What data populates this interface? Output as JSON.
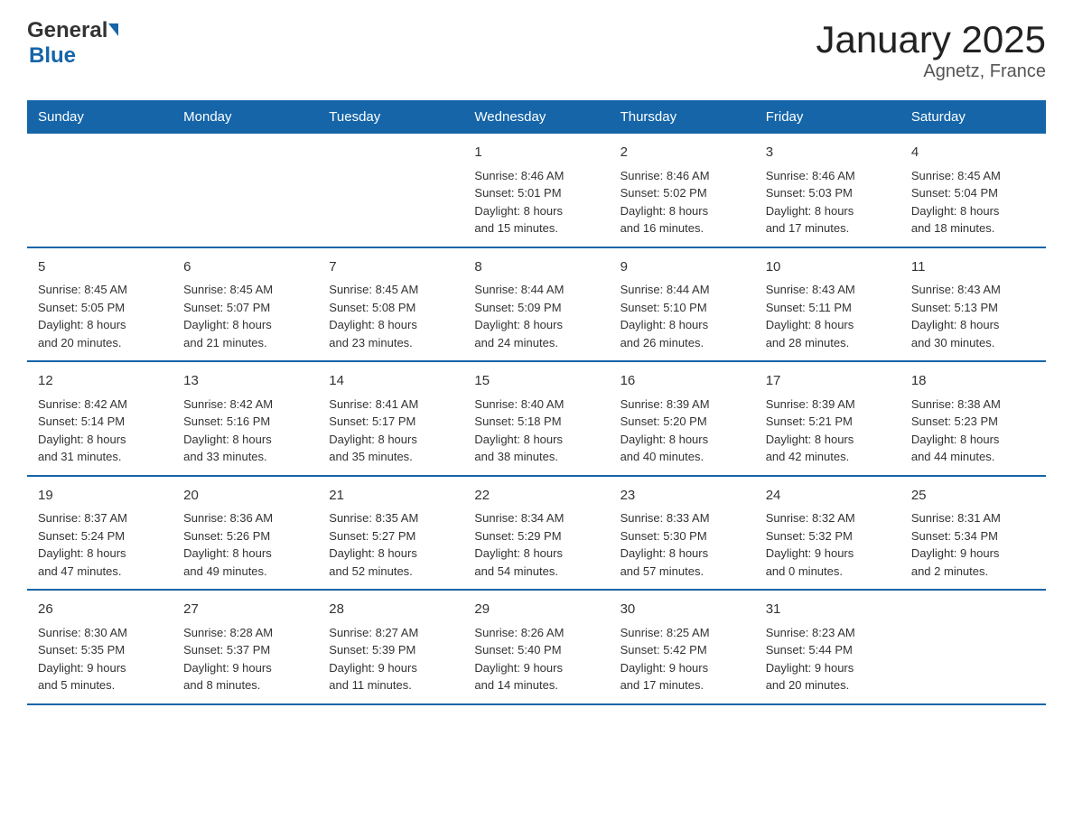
{
  "header": {
    "logo_general": "General",
    "logo_blue": "Blue",
    "title": "January 2025",
    "subtitle": "Agnetz, France"
  },
  "days_of_week": [
    "Sunday",
    "Monday",
    "Tuesday",
    "Wednesday",
    "Thursday",
    "Friday",
    "Saturday"
  ],
  "weeks": [
    [
      {
        "day": "",
        "info": ""
      },
      {
        "day": "",
        "info": ""
      },
      {
        "day": "",
        "info": ""
      },
      {
        "day": "1",
        "info": "Sunrise: 8:46 AM\nSunset: 5:01 PM\nDaylight: 8 hours\nand 15 minutes."
      },
      {
        "day": "2",
        "info": "Sunrise: 8:46 AM\nSunset: 5:02 PM\nDaylight: 8 hours\nand 16 minutes."
      },
      {
        "day": "3",
        "info": "Sunrise: 8:46 AM\nSunset: 5:03 PM\nDaylight: 8 hours\nand 17 minutes."
      },
      {
        "day": "4",
        "info": "Sunrise: 8:45 AM\nSunset: 5:04 PM\nDaylight: 8 hours\nand 18 minutes."
      }
    ],
    [
      {
        "day": "5",
        "info": "Sunrise: 8:45 AM\nSunset: 5:05 PM\nDaylight: 8 hours\nand 20 minutes."
      },
      {
        "day": "6",
        "info": "Sunrise: 8:45 AM\nSunset: 5:07 PM\nDaylight: 8 hours\nand 21 minutes."
      },
      {
        "day": "7",
        "info": "Sunrise: 8:45 AM\nSunset: 5:08 PM\nDaylight: 8 hours\nand 23 minutes."
      },
      {
        "day": "8",
        "info": "Sunrise: 8:44 AM\nSunset: 5:09 PM\nDaylight: 8 hours\nand 24 minutes."
      },
      {
        "day": "9",
        "info": "Sunrise: 8:44 AM\nSunset: 5:10 PM\nDaylight: 8 hours\nand 26 minutes."
      },
      {
        "day": "10",
        "info": "Sunrise: 8:43 AM\nSunset: 5:11 PM\nDaylight: 8 hours\nand 28 minutes."
      },
      {
        "day": "11",
        "info": "Sunrise: 8:43 AM\nSunset: 5:13 PM\nDaylight: 8 hours\nand 30 minutes."
      }
    ],
    [
      {
        "day": "12",
        "info": "Sunrise: 8:42 AM\nSunset: 5:14 PM\nDaylight: 8 hours\nand 31 minutes."
      },
      {
        "day": "13",
        "info": "Sunrise: 8:42 AM\nSunset: 5:16 PM\nDaylight: 8 hours\nand 33 minutes."
      },
      {
        "day": "14",
        "info": "Sunrise: 8:41 AM\nSunset: 5:17 PM\nDaylight: 8 hours\nand 35 minutes."
      },
      {
        "day": "15",
        "info": "Sunrise: 8:40 AM\nSunset: 5:18 PM\nDaylight: 8 hours\nand 38 minutes."
      },
      {
        "day": "16",
        "info": "Sunrise: 8:39 AM\nSunset: 5:20 PM\nDaylight: 8 hours\nand 40 minutes."
      },
      {
        "day": "17",
        "info": "Sunrise: 8:39 AM\nSunset: 5:21 PM\nDaylight: 8 hours\nand 42 minutes."
      },
      {
        "day": "18",
        "info": "Sunrise: 8:38 AM\nSunset: 5:23 PM\nDaylight: 8 hours\nand 44 minutes."
      }
    ],
    [
      {
        "day": "19",
        "info": "Sunrise: 8:37 AM\nSunset: 5:24 PM\nDaylight: 8 hours\nand 47 minutes."
      },
      {
        "day": "20",
        "info": "Sunrise: 8:36 AM\nSunset: 5:26 PM\nDaylight: 8 hours\nand 49 minutes."
      },
      {
        "day": "21",
        "info": "Sunrise: 8:35 AM\nSunset: 5:27 PM\nDaylight: 8 hours\nand 52 minutes."
      },
      {
        "day": "22",
        "info": "Sunrise: 8:34 AM\nSunset: 5:29 PM\nDaylight: 8 hours\nand 54 minutes."
      },
      {
        "day": "23",
        "info": "Sunrise: 8:33 AM\nSunset: 5:30 PM\nDaylight: 8 hours\nand 57 minutes."
      },
      {
        "day": "24",
        "info": "Sunrise: 8:32 AM\nSunset: 5:32 PM\nDaylight: 9 hours\nand 0 minutes."
      },
      {
        "day": "25",
        "info": "Sunrise: 8:31 AM\nSunset: 5:34 PM\nDaylight: 9 hours\nand 2 minutes."
      }
    ],
    [
      {
        "day": "26",
        "info": "Sunrise: 8:30 AM\nSunset: 5:35 PM\nDaylight: 9 hours\nand 5 minutes."
      },
      {
        "day": "27",
        "info": "Sunrise: 8:28 AM\nSunset: 5:37 PM\nDaylight: 9 hours\nand 8 minutes."
      },
      {
        "day": "28",
        "info": "Sunrise: 8:27 AM\nSunset: 5:39 PM\nDaylight: 9 hours\nand 11 minutes."
      },
      {
        "day": "29",
        "info": "Sunrise: 8:26 AM\nSunset: 5:40 PM\nDaylight: 9 hours\nand 14 minutes."
      },
      {
        "day": "30",
        "info": "Sunrise: 8:25 AM\nSunset: 5:42 PM\nDaylight: 9 hours\nand 17 minutes."
      },
      {
        "day": "31",
        "info": "Sunrise: 8:23 AM\nSunset: 5:44 PM\nDaylight: 9 hours\nand 20 minutes."
      },
      {
        "day": "",
        "info": ""
      }
    ]
  ]
}
